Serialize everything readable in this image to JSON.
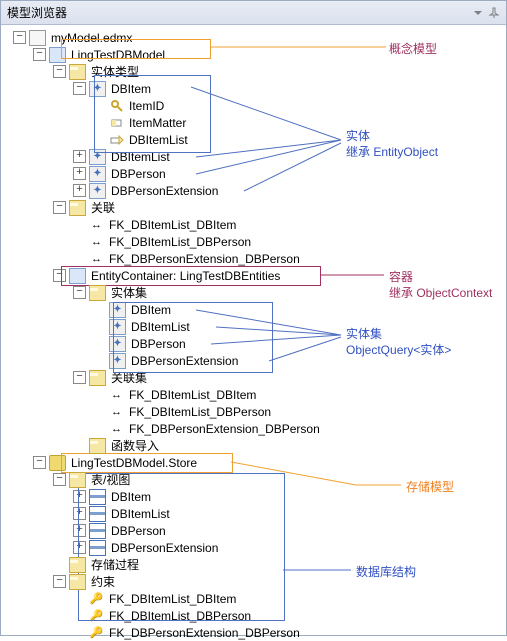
{
  "title": "模型浏览器",
  "root": "myModel.edmx",
  "concept_model": "LingTestDBModel",
  "folders": {
    "entity_types": "实体类型",
    "associations": "关联",
    "entity_sets": "实体集",
    "assoc_sets": "关联集",
    "func_imports": "函数导入",
    "tables_views": "表/视图",
    "sprocs": "存储过程",
    "constraints": "约束"
  },
  "dbitem": "DBItem",
  "props": {
    "itemid": "ItemID",
    "itemmatter": "ItemMatter",
    "dbitemlist": "DBItemList"
  },
  "types": {
    "dbitemlist": "DBItemList",
    "dbperson": "DBPerson",
    "dbpersonext": "DBPersonExtension"
  },
  "fks": {
    "a": "FK_DBItemList_DBItem",
    "b": "FK_DBItemList_DBPerson",
    "c": "FK_DBPersonExtension_DBPerson"
  },
  "container": "EntityContainer: LingTestDBEntities",
  "sets": {
    "dbitem": "DBItem",
    "dbitemlist": "DBItemList",
    "dbperson": "DBPerson",
    "dbpersonext": "DBPersonExtension"
  },
  "store": "LingTestDBModel.Store",
  "tables": {
    "dbitem": "DBItem",
    "dbitemlist": "DBItemList",
    "dbperson": "DBPerson",
    "dbpersonext": "DBPersonExtension"
  },
  "anno": {
    "concept": "概念模型",
    "entity_l1": "实体",
    "entity_l2": "继承 EntityObject",
    "container_l1": "容器",
    "container_l2": "继承  ObjectContext",
    "set_l1": "实体集",
    "set_l2": "ObjectQuery<实体>",
    "storage": "存储模型",
    "dbstruct": "数据库结构"
  },
  "toggles": {
    "minus": "−",
    "plus": "+"
  }
}
